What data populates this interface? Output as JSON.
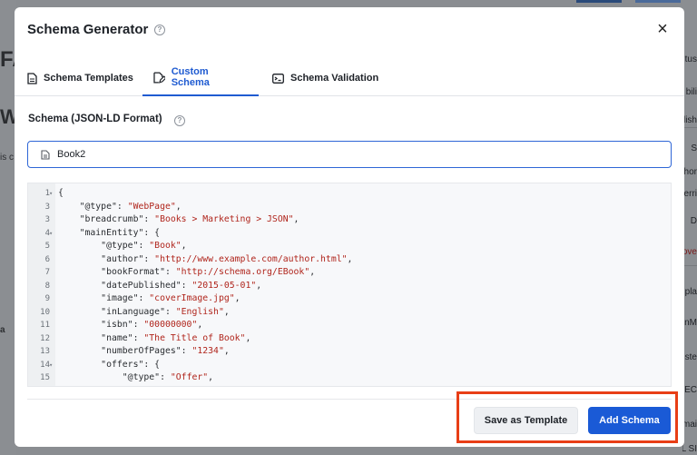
{
  "background": {
    "left_letters": [
      "FA",
      "W",
      "is c",
      "a"
    ],
    "right_items": [
      "tus",
      "bili",
      "lish",
      "S",
      "hor",
      "erri",
      "D",
      "ove",
      "pla",
      "inM",
      "nste",
      "SEC",
      "mai",
      "URL SI"
    ]
  },
  "modal": {
    "title": "Schema Generator",
    "close_label": "×",
    "help_glyph": "?"
  },
  "tabs": [
    {
      "label": "Schema Templates",
      "icon": "document-icon",
      "active": false
    },
    {
      "label": "Custom Schema",
      "icon": "edit-document-icon",
      "active": true
    },
    {
      "label": "Schema Validation",
      "icon": "terminal-icon",
      "active": false
    }
  ],
  "form": {
    "section_label": "Schema (JSON-LD Format)",
    "name_value": "Book2"
  },
  "editor": {
    "lines": [
      {
        "n": "1",
        "fold": true,
        "key": "{",
        "sep": "",
        "val": "",
        "tail": ""
      },
      {
        "n": "3",
        "fold": false,
        "key": "    \"@type\"",
        "sep": ": ",
        "val": "\"WebPage\"",
        "tail": ","
      },
      {
        "n": "3",
        "fold": false,
        "key": "    \"breadcrumb\"",
        "sep": ": ",
        "val": "\"Books > Marketing > JSON\"",
        "tail": ","
      },
      {
        "n": "4",
        "fold": true,
        "key": "    \"mainEntity\"",
        "sep": ": {",
        "val": "",
        "tail": ""
      },
      {
        "n": "5",
        "fold": false,
        "key": "        \"@type\"",
        "sep": ": ",
        "val": "\"Book\"",
        "tail": ","
      },
      {
        "n": "6",
        "fold": false,
        "key": "        \"author\"",
        "sep": ": ",
        "val": "\"http://www.example.com/author.html\"",
        "tail": ","
      },
      {
        "n": "7",
        "fold": false,
        "key": "        \"bookFormat\"",
        "sep": ": ",
        "val": "\"http://schema.org/EBook\"",
        "tail": ","
      },
      {
        "n": "8",
        "fold": false,
        "key": "        \"datePublished\"",
        "sep": ": ",
        "val": "\"2015-05-01\"",
        "tail": ","
      },
      {
        "n": "9",
        "fold": false,
        "key": "        \"image\"",
        "sep": ": ",
        "val": "\"coverImage.jpg\"",
        "tail": ","
      },
      {
        "n": "10",
        "fold": false,
        "key": "        \"inLanguage\"",
        "sep": ": ",
        "val": "\"English\"",
        "tail": ","
      },
      {
        "n": "11",
        "fold": false,
        "key": "        \"isbn\"",
        "sep": ": ",
        "val": "\"00000000\"",
        "tail": ","
      },
      {
        "n": "12",
        "fold": false,
        "key": "        \"name\"",
        "sep": ": ",
        "val": "\"The Title of Book\"",
        "tail": ","
      },
      {
        "n": "13",
        "fold": false,
        "key": "        \"numberOfPages\"",
        "sep": ": ",
        "val": "\"1234\"",
        "tail": ","
      },
      {
        "n": "14",
        "fold": true,
        "key": "        \"offers\"",
        "sep": ": {",
        "val": "",
        "tail": ""
      },
      {
        "n": "15",
        "fold": false,
        "key": "            \"@type\"",
        "sep": ": ",
        "val": "\"Offer\"",
        "tail": ","
      }
    ]
  },
  "footer": {
    "save_template_label": "Save as Template",
    "add_schema_label": "Add Schema"
  },
  "colors": {
    "accent": "#1a5ad6",
    "string": "#b0251c",
    "highlight": "#e83e16"
  }
}
